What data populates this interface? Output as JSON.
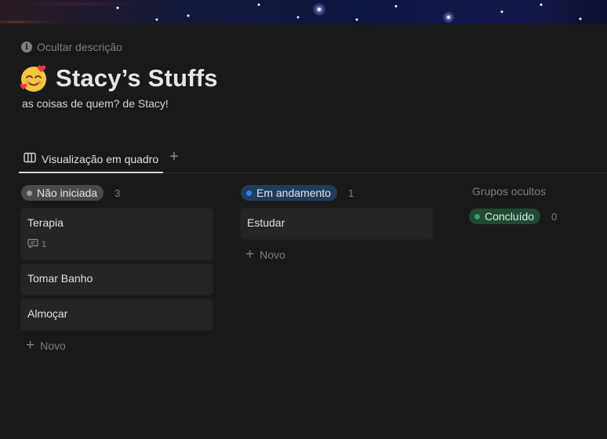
{
  "header": {
    "toggle_description_label": "Ocultar descrição",
    "toggle_icon": "info-icon",
    "page_emoji": "smiling-face-with-hearts",
    "page_title": "Stacy’s Stuffs",
    "page_description": "as coisas de quem? de Stacy!"
  },
  "views": {
    "tabs": [
      {
        "label": "Visualização em quadro",
        "icon": "board-view-icon",
        "active": true
      }
    ],
    "add_view_icon": "plus-icon"
  },
  "board": {
    "groups": [
      {
        "label": "Não iniciada",
        "color": "#9b9b9b",
        "pill_bg": "#4a4a4a",
        "count": "3",
        "cards": [
          {
            "title": "Terapia",
            "comments": "1"
          },
          {
            "title": "Tomar Banho"
          },
          {
            "title": "Almoçar"
          }
        ],
        "new_label": "Novo"
      },
      {
        "label": "Em andamento",
        "color": "#2f80ed",
        "pill_bg": "#213b5c",
        "count": "1",
        "cards": [
          {
            "title": "Estudar"
          }
        ],
        "new_label": "Novo"
      }
    ],
    "hidden_groups": {
      "title": "Grupos ocultos",
      "items": [
        {
          "label": "Concluído",
          "color": "#2ea36b",
          "pill_bg": "#1f4a33",
          "count": "0"
        }
      ]
    }
  }
}
